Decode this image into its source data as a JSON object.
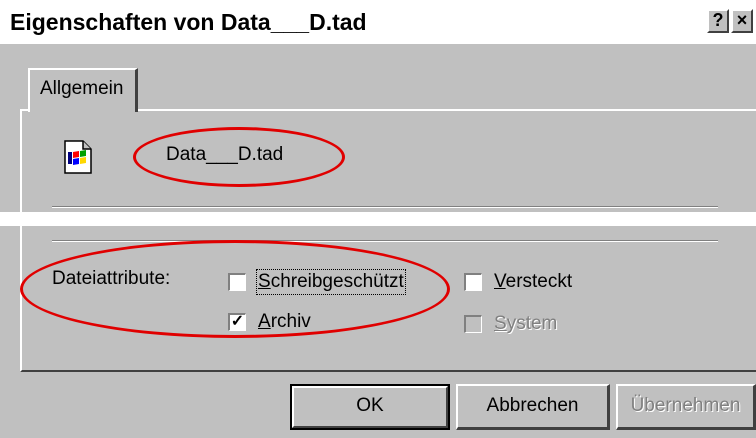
{
  "window": {
    "title": "Eigenschaften von Data___D.tad",
    "help_label": "?",
    "close_label": "×"
  },
  "tabs": [
    {
      "label": "Allgemein",
      "active": true
    }
  ],
  "file": {
    "name": "Data___D.tad",
    "icon": "windows-file-icon"
  },
  "attributes": {
    "label": "Dateiattribute:",
    "checkboxes": [
      {
        "label_u": "S",
        "label_rest": "chreibgeschützt",
        "checked": false,
        "disabled": false
      },
      {
        "label_u": "A",
        "label_rest": "rchiv",
        "checked": true,
        "disabled": false
      },
      {
        "label_u": "V",
        "label_rest": "ersteckt",
        "checked": false,
        "disabled": false
      },
      {
        "label_u": "S",
        "label_rest": "ystem",
        "checked": false,
        "disabled": true
      }
    ]
  },
  "buttons": {
    "ok": "OK",
    "cancel": "Abbrechen",
    "apply": "Übernehmen"
  },
  "colors": {
    "face": "#c0c0c0",
    "highlight_ellipse": "#e00000"
  }
}
